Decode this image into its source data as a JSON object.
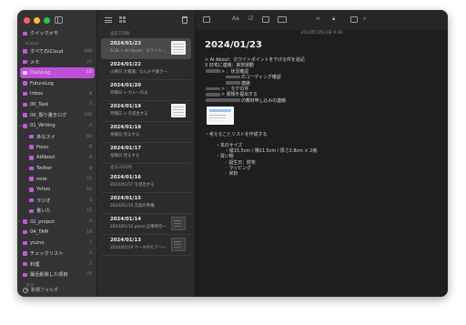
{
  "sidebar": {
    "sections": {
      "top": "",
      "icloud": "iCloud",
      "bottom": "タグ"
    },
    "folders": [
      {
        "label": "クイックメモ",
        "count": "",
        "sub": false,
        "chev": false
      },
      {
        "label": "すべてのiCloud",
        "count": "446",
        "sub": false,
        "chev": false
      },
      {
        "label": "メモ",
        "count": "21",
        "sub": false,
        "chev": false
      },
      {
        "label": "DailyLog",
        "count": "10",
        "sub": false,
        "chev": false,
        "active": true
      },
      {
        "label": "FutureLog",
        "count": "",
        "sub": false,
        "chev": false
      },
      {
        "label": "Inbox",
        "count": "8",
        "sub": false,
        "chev": false
      },
      {
        "label": "00_Task",
        "count": "5",
        "sub": false,
        "chev": false
      },
      {
        "label": "00_振り書きログ",
        "count": "195",
        "sub": false,
        "chev": false
      },
      {
        "label": "01_Writing",
        "count": "0",
        "sub": false,
        "chev": true,
        "chev_glyph": "⌄"
      },
      {
        "label": "あなスイ",
        "count": "60",
        "sub": true,
        "chev": false
      },
      {
        "label": "Poizo",
        "count": "8",
        "sub": true,
        "chev": false
      },
      {
        "label": "AIAbout",
        "count": "9",
        "sub": true,
        "chev": false
      },
      {
        "label": "Twitter",
        "count": "9",
        "sub": true,
        "chev": false
      },
      {
        "label": "note",
        "count": "21",
        "sub": true,
        "chev": false
      },
      {
        "label": "Yohoo",
        "count": "61",
        "sub": true,
        "chev": false
      },
      {
        "label": "ラジオ",
        "count": "5",
        "sub": true,
        "chev": false
      },
      {
        "label": "書いた",
        "count": "15",
        "sub": true,
        "chev": false
      },
      {
        "label": "02_project",
        "count": "0",
        "sub": false,
        "chev": true,
        "chev_glyph": "›"
      },
      {
        "label": "04_TAM",
        "count": "19",
        "sub": false,
        "chev": false
      },
      {
        "label": "yuzno",
        "count": "1",
        "sub": false,
        "chev": false
      },
      {
        "label": "チェックリスト",
        "count": "3",
        "sub": false,
        "chev": false
      },
      {
        "label": "料理",
        "count": "7",
        "sub": false,
        "chev": false
      },
      {
        "label": "最近削除した項目",
        "count": "75",
        "sub": false,
        "chev": false
      }
    ],
    "new_folder": "新規フォルダ"
  },
  "notelist": {
    "section_7days": "過去7日間",
    "section_30days": "過去30日間",
    "notes": [
      {
        "title": "2024/01/23",
        "sub": "9:36  > AI About：ホワイト…",
        "selected": true,
        "thumb": "light"
      },
      {
        "title": "2024/01/22",
        "sub": "火曜日  大賞議：なんかや書き一",
        "selected": false,
        "thumb": ""
      },
      {
        "title": "2024/01/20",
        "sub": "月曜日  > カレー作る",
        "selected": false,
        "thumb": ""
      },
      {
        "title": "2024/01/19",
        "sub": "月曜日  >           を提出する",
        "selected": false,
        "thumb": "light"
      },
      {
        "title": "2024/01/18",
        "sub": "金曜日            見るする",
        "selected": false,
        "thumb": ""
      },
      {
        "title": "2024/01/17",
        "sub": "金曜日            見るする",
        "selected": false,
        "thumb": ""
      },
      {
        "title": "2024/01/16",
        "sub": "2024/01/17          を提出する",
        "selected": false,
        "thumb": "",
        "section_before": true
      },
      {
        "title": "2024/01/15",
        "sub": "2024/01/16  方案の準備",
        "selected": false,
        "thumb": ""
      },
      {
        "title": "2024/01/14",
        "sub": "2024/01/15  poizo 記事制作一",
        "selected": false,
        "thumb": "dark"
      },
      {
        "title": "2024/01/13",
        "sub": "2024/01/14  ケーキのヒアリー",
        "selected": false,
        "thumb": "dark"
      }
    ]
  },
  "editor": {
    "toolbar": {
      "format": "Aa"
    },
    "date_line": "2024年1月23日 9:36",
    "title": "2024/01/23",
    "lines": [
      {
        "text": "> AI About：ホワイトポイントを下げる件を追記",
        "ind": 0,
        "blur": 0
      },
      {
        "text": "X 旧宅に連絡：挨拶運動",
        "ind": 0,
        "blur": 0
      },
      {
        "text": ">         ：状況確認",
        "ind": 0,
        "blur": 1
      },
      {
        "text": "のコーディング確認",
        "ind": 2,
        "blur": 2
      },
      {
        "text": "連絡",
        "ind": 2,
        "blur": 2
      },
      {
        "text": ">         ：タグの件",
        "ind": 0,
        "blur": 1
      },
      {
        "text": ">         書類を提出する",
        "ind": 0,
        "blur": 1
      },
      {
        "text": "の教材申し込みの連絡",
        "ind": 0,
        "blur": 3
      }
    ],
    "list_header": "・考えることリストを作成する",
    "list": [
      {
        "text": "・本のサイズ",
        "ind": 1
      },
      {
        "text": "・縦15.5cm / 横11.5cm / 厚さ2.8cm × 2冊",
        "ind": 2
      },
      {
        "text": "・買い物",
        "ind": 1
      },
      {
        "text": "◦       誕生日：財布",
        "ind": 2
      },
      {
        "text": "◦ ラッピング",
        "ind": 2
      },
      {
        "text": "◦ 米粉",
        "ind": 2
      }
    ]
  }
}
